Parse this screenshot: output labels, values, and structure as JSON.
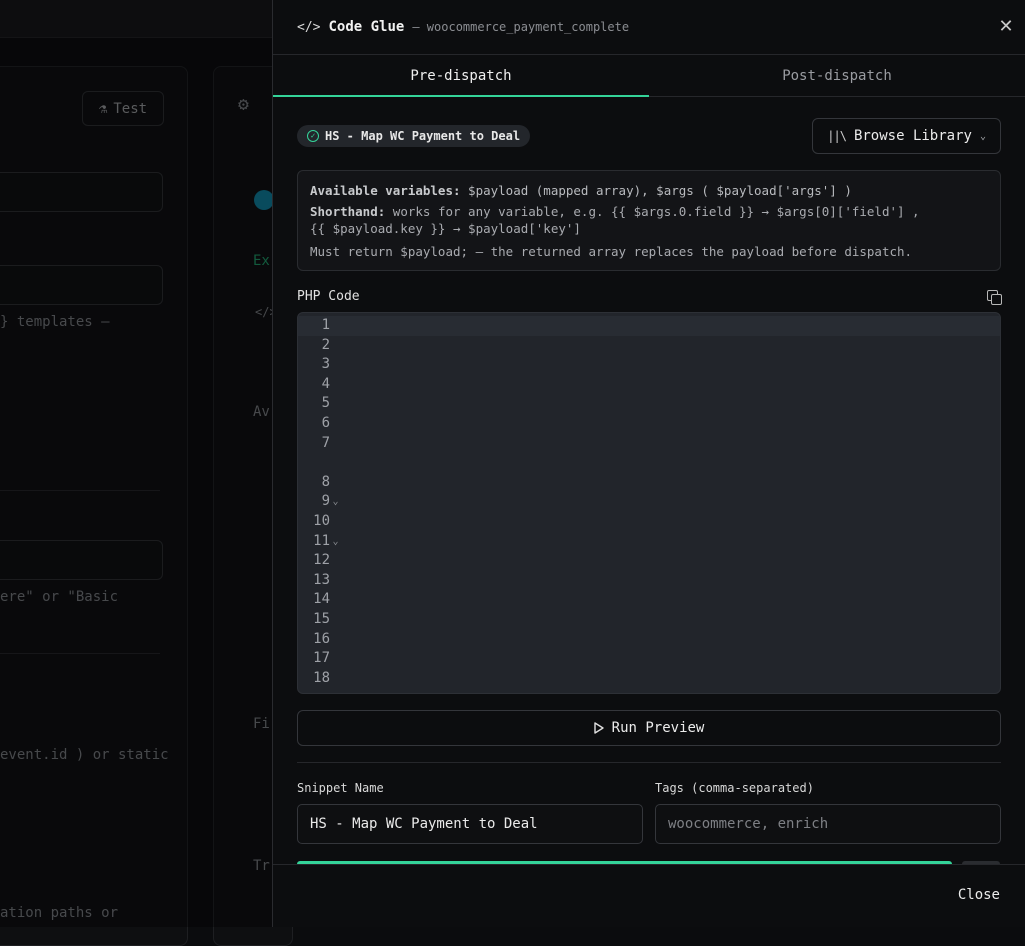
{
  "background": {
    "test_button": "Test",
    "templates_text": "}  templates —",
    "basic_text": "ere\" or \"Basic",
    "static_text": "event.id ) or static",
    "paths_text": "ation paths or",
    "mid_ex": "Ex",
    "mid_code": "</>",
    "mid_av": "Av",
    "mid_fi": "Fi",
    "mid_tr": "Tr"
  },
  "drawer": {
    "title": "Code Glue",
    "subtitle": "— woocommerce_payment_complete",
    "tabs": [
      {
        "label": "Pre-dispatch",
        "active": true
      },
      {
        "label": "Post-dispatch",
        "active": false
      }
    ],
    "snippet_badge": "HS - Map WC Payment to Deal",
    "browse_button": "Browse Library",
    "vars": {
      "avail_label": "Available variables:",
      "avail_text": " $payload  (mapped array),  $args  ( $payload['args'] )",
      "short_label": "Shorthand:",
      "short_text": " works for any variable, e.g.  {{ $args.0.field }}  →  $args[0]['field'] ,",
      "short_text2": " {{ $payload.key }}  →  $payload['key']",
      "must_text": "Must  return $payload;  — the returned array replaces the payload before dispatch."
    },
    "code_label": "PHP Code",
    "line_numbers": [
      "1",
      "2",
      "3",
      "4",
      "5",
      "6",
      "7",
      "",
      "8",
      "9",
      "10",
      "11",
      "12",
      "13",
      "14",
      "15",
      "16",
      "17",
      "18"
    ],
    "run_preview": "Run Preview",
    "snippet_name_label": "Snippet Name",
    "snippet_name_value": "HS - Map WC Payment to Deal",
    "tags_label": "Tags (comma-separated)",
    "tags_placeholder": "woocommerce, enrich",
    "close_button": "Close"
  },
  "colors": {
    "accent": "#34d399",
    "background": "#0c0d0f",
    "editor_bg": "#22252b"
  }
}
